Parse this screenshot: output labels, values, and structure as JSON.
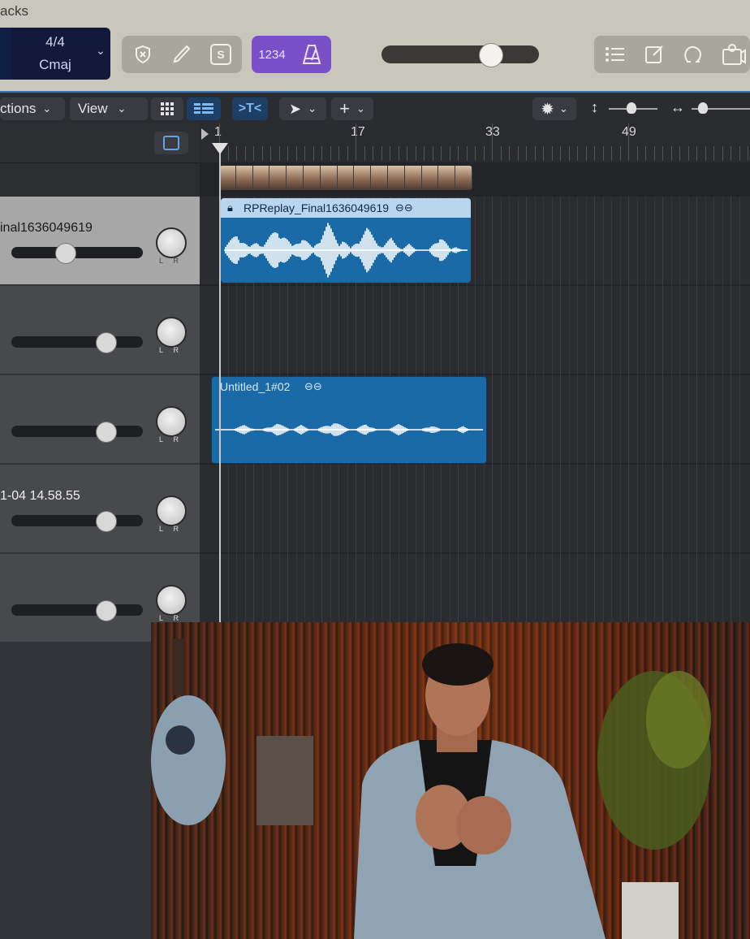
{
  "window": {
    "title": "acks"
  },
  "control_bar": {
    "lcd": {
      "time_signature": "4/4",
      "key": "Cmaj"
    },
    "count_in_label": "1234",
    "solo_label": "S"
  },
  "toolbar": {
    "functions_label": "ctions",
    "view_label": "View"
  },
  "ruler": {
    "bars": [
      "1",
      "17",
      "33",
      "49"
    ]
  },
  "tracks": [
    {
      "name": "inal1636049619",
      "volume_level": 0.4,
      "selected": true
    },
    {
      "name": "",
      "volume_level": 0.72,
      "selected": false
    },
    {
      "name": "",
      "volume_level": 0.72,
      "selected": false
    },
    {
      "name": "1-04 14.58.55",
      "volume_level": 0.72,
      "selected": false
    },
    {
      "name": "",
      "volume_level": 0.72,
      "selected": false
    }
  ],
  "regions": [
    {
      "name": "RPReplay_Final1636049619",
      "track": 1
    },
    {
      "name": "Untitled_1#02",
      "track": 3
    }
  ],
  "colors": {
    "accent": "#1a6aa8",
    "count_in": "#7a50c9",
    "lcd": "#13193a"
  },
  "icons": {
    "control": [
      "key-icon",
      "pencil-icon",
      "solo-icon",
      "metronome-icon"
    ],
    "right": [
      "list-icon",
      "note-pad-icon",
      "loop-icon",
      "media-icon"
    ]
  }
}
